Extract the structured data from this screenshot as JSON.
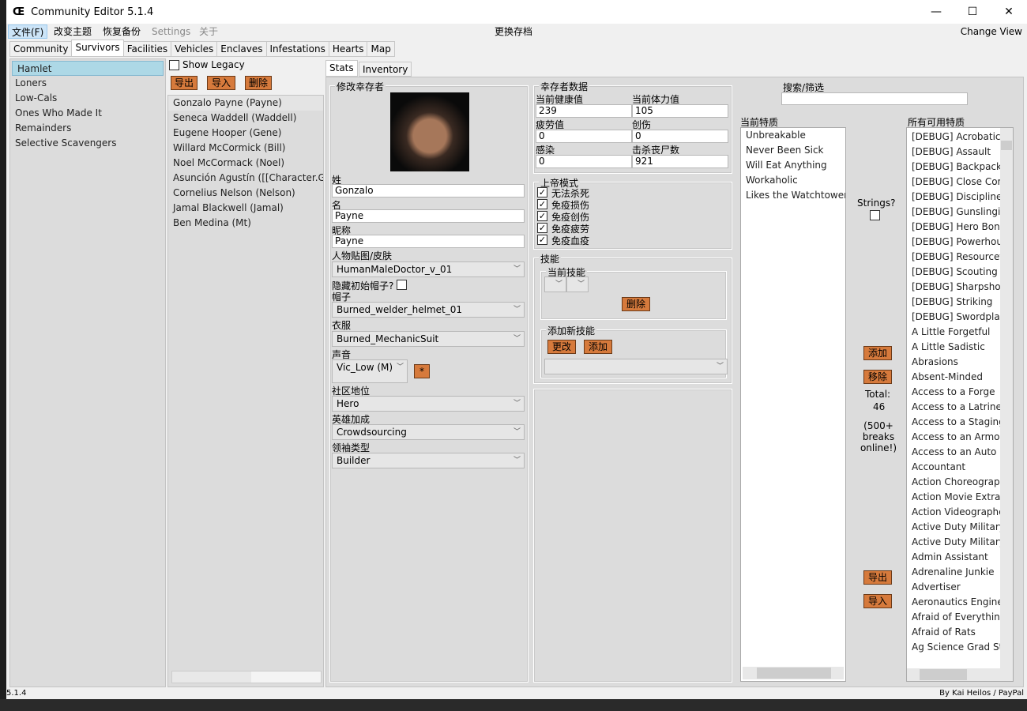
{
  "window": {
    "title": "Community Editor 5.1.4",
    "minimize": "—",
    "maximize": "☐",
    "close": "✕"
  },
  "menu": {
    "items": [
      "文件(F)",
      "改变主题",
      "恢复备份",
      "Settings",
      "关于"
    ],
    "center": "更换存档",
    "right": "Change View"
  },
  "tabs": [
    "Community",
    "Survivors",
    "Facilities",
    "Vehicles",
    "Enclaves",
    "Infestations",
    "Hearts",
    "Map"
  ],
  "communities": [
    "Hamlet",
    "Loners",
    "Low-Cals",
    "Ones Who Made It",
    "Remainders",
    "Selective Scavengers"
  ],
  "survivor_panel": {
    "show_legacy": "Show Legacy",
    "export": "导出",
    "import": "导入",
    "delete": "删除",
    "survivors": [
      "Gonzalo Payne (Payne)",
      "Seneca Waddell (Waddell)",
      "Eugene Hooper (Gene)",
      "Willard McCormick (Bill)",
      "Noel McCormack (Noel)",
      "Asunción Agustín ([[Character.Ge",
      "Cornelius Nelson (Nelson)",
      "Jamal Blackwell (Jamal)",
      "Ben Medina (Mt)"
    ]
  },
  "subtabs": [
    "Stats",
    "Inventory"
  ],
  "edit": {
    "title": "修改幸存者",
    "last_name_label": "姓",
    "last_name": "Gonzalo",
    "first_name_label": "名",
    "first_name": "Payne",
    "nickname_label": "昵称",
    "nickname": "Payne",
    "skin_label": "人物贴图/皮肤",
    "skin": "HumanMaleDoctor_v_01",
    "hide_hat_label": "隐藏初始帽子?",
    "hat_label": "帽子",
    "hat": "Burned_welder_helmet_01",
    "clothes_label": "衣服",
    "clothes": "Burned_MechanicSuit",
    "voice_label": "声音",
    "voice": "Vic_Low (M)",
    "voice_btn": "*",
    "standing_label": "社区地位",
    "standing": "Hero",
    "hero_bonus_label": "英雄加成",
    "hero_bonus": "Crowdsourcing",
    "leader_label": "领袖类型",
    "leader": "Builder"
  },
  "stats": {
    "title": "幸存者数据",
    "health_label": "当前健康值",
    "health": "239",
    "stamina_label": "当前体力值",
    "stamina": "105",
    "fatigue_label": "疲劳值",
    "fatigue": "0",
    "trauma_label": "创伤",
    "trauma": "0",
    "infection_label": "感染",
    "infection": "0",
    "kills_label": "击杀丧尸数",
    "kills": "921"
  },
  "god_mode": {
    "title": "上帝模式",
    "options": [
      "无法杀死",
      "免疫损伤",
      "免疫创伤",
      "免疫疲劳",
      "免疫血疫"
    ],
    "checked": [
      true,
      true,
      true,
      true,
      true
    ]
  },
  "skills": {
    "title": "技能",
    "current_title": "当前技能",
    "delete": "删除",
    "add_title": "添加新技能",
    "change": "更改",
    "add": "添加"
  },
  "search": {
    "title": "搜索/筛选",
    "value": ""
  },
  "current_traits": {
    "title": "当前特质",
    "items": [
      "Unbreakable",
      "Never Been Sick",
      "Will Eat Anything",
      "Workaholic",
      "Likes the Watchtower"
    ]
  },
  "middle": {
    "strings": "Strings?",
    "add": "添加",
    "remove": "移除",
    "total": "Total:",
    "total_count": "46",
    "note": "(500+ breaks online!)",
    "export": "导出",
    "import": "导入"
  },
  "all_traits": {
    "title": "所有可用特质",
    "items": [
      "[DEBUG] Acrobatics",
      "[DEBUG] Assault",
      "[DEBUG] Backpacking",
      "[DEBUG] Close Combat",
      "[DEBUG] Discipline",
      "[DEBUG] Gunslinging",
      "[DEBUG] Hero Bonus",
      "[DEBUG] Powerhouse",
      "[DEBUG] Resourcefulness",
      "[DEBUG] Scouting",
      "[DEBUG] Sharpshooting",
      "[DEBUG] Striking",
      "[DEBUG] Swordplay",
      "A Little Forgetful",
      "A Little Sadistic",
      "Abrasions",
      "Absent-Minded",
      "Access to a Forge",
      "Access to a Latrine",
      "Access to a Staging",
      "Access to an Armory",
      "Access to an Auto Shop",
      "Accountant",
      "Action Choreographer",
      "Action Movie Extra",
      "Action Videographer",
      "Active Duty Military",
      "Active Duty Military",
      "Admin Assistant",
      "Adrenaline Junkie",
      "Advertiser",
      "Aeronautics Engineer",
      "Afraid of Everything",
      "Afraid of Rats",
      "Ag Science Grad Student"
    ]
  },
  "status": {
    "left": "5.1.4",
    "right": "By Kai Heilos / PayPal"
  }
}
